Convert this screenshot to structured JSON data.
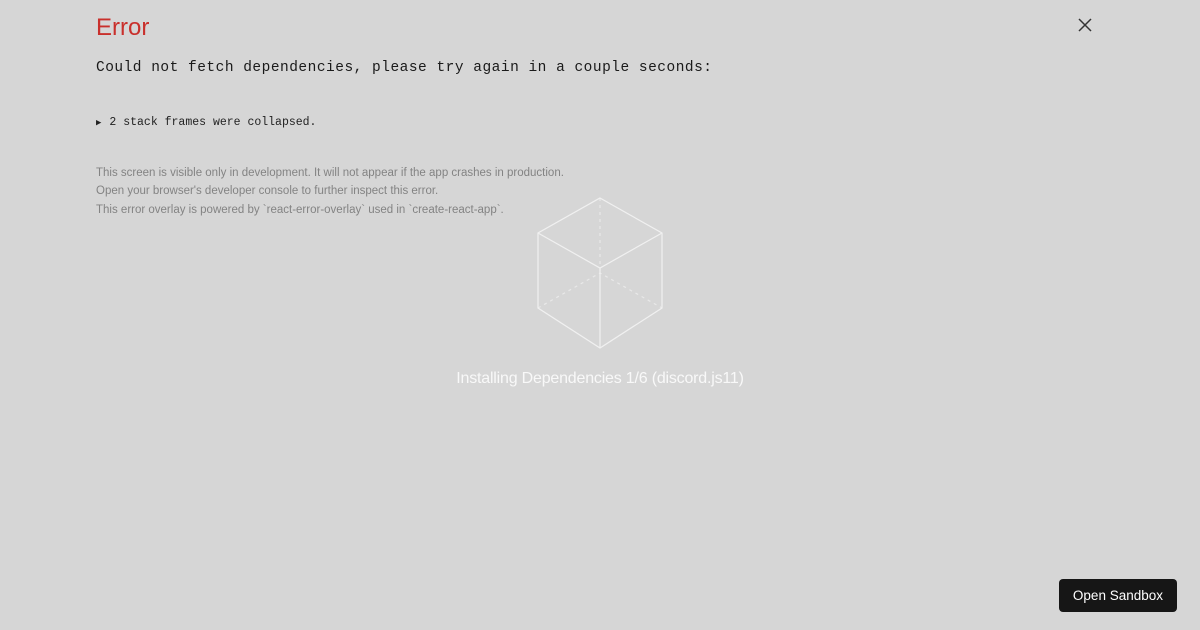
{
  "background": {
    "loading_text": "Installing Dependencies 1/6 (discord.js11)"
  },
  "overlay": {
    "title": "Error",
    "message": "Could not fetch dependencies, please try again in a couple seconds:",
    "collapsed_text": "2 stack frames were collapsed.",
    "help_line1": "This screen is visible only in development. It will not appear if the app crashes in production.",
    "help_line2": "Open your browser's developer console to further inspect this error.",
    "help_line3": "This error overlay is powered by `react-error-overlay` used in `create-react-app`."
  },
  "button": {
    "open_sandbox": "Open Sandbox"
  }
}
